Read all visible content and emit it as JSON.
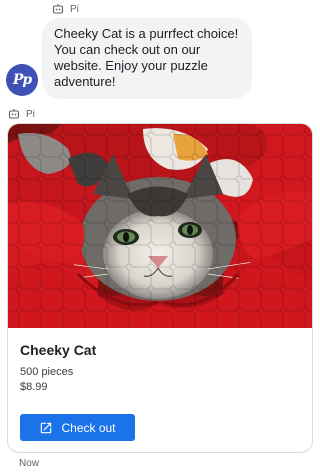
{
  "messages": {
    "first": {
      "sender": "Pi",
      "text": "Cheeky Cat is a purrfect choice! You can check out on our website. Enjoy your puzzle adventure!"
    },
    "second": {
      "sender": "Pi"
    }
  },
  "avatar": {
    "initials": "Pp",
    "color": "#3f51b5"
  },
  "card": {
    "image_subject": "cat-puzzle-image",
    "title": "Cheeky Cat",
    "pieces": "500 pieces",
    "price": "$8.99",
    "button_label": "Check out",
    "button_color": "#1a73e8"
  },
  "timestamp": "Now",
  "icons": [
    "bot-icon",
    "open-in-new-icon"
  ]
}
